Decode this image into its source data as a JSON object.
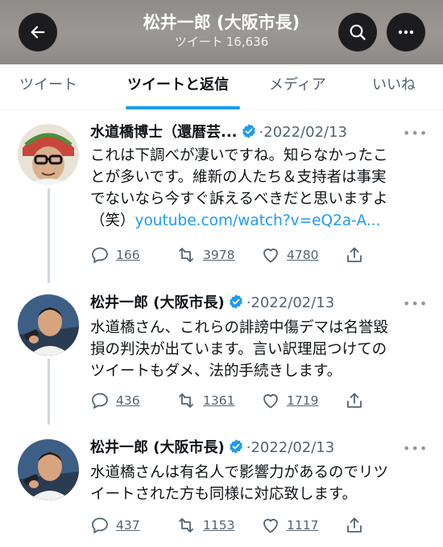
{
  "header": {
    "title": "松井一郎 (大阪市長)",
    "tweets_label": "ツイート",
    "tweet_count": "16,636"
  },
  "tabs": [
    {
      "label": "ツイート",
      "active": false
    },
    {
      "label": "ツイートと返信",
      "active": true
    },
    {
      "label": "メディア",
      "active": false
    },
    {
      "label": "いいね",
      "active": false
    }
  ],
  "tweets": [
    {
      "author": "水道橋博士（還暦芸...",
      "verified": true,
      "separator": "·",
      "date": "2022/02/13",
      "more": "•••",
      "lines": [
        "これは下調べが凄いですね。知らなかったこ",
        "とが多いです。維新の人たち＆支持者は事実",
        "でないなら今すぐ訴えるべきだと思いますよ"
      ],
      "last_line_prefix": "（笑）",
      "link": "youtube.com/watch?v=eQ2a-A...",
      "replies": "166",
      "retweets": "3978",
      "likes": "4780"
    },
    {
      "author": "松井一郎 (大阪市長)",
      "verified": true,
      "separator": "·",
      "date": "2022/02/13",
      "more": "•••",
      "lines": [
        "水道橋さん、これらの誹謗中傷デマは名誉毀",
        "損の判決が出ています。言い訳理屈つけての",
        "ツイートもダメ、法的手続きします。"
      ],
      "replies": "436",
      "retweets": "1361",
      "likes": "1719"
    },
    {
      "author": "松井一郎 (大阪市長)",
      "verified": true,
      "separator": "·",
      "date": "2022/02/13",
      "more": "•••",
      "lines": [
        "水道橋さんは有名人で影響力があるのでリツ",
        "イートされた方も同様に対応致します。"
      ],
      "replies": "437",
      "retweets": "1153",
      "likes": "1117"
    }
  ],
  "colors": {
    "accent": "#1d9bf0",
    "text": "#0f1419",
    "muted": "#536471",
    "header_bg": "#94918e"
  }
}
